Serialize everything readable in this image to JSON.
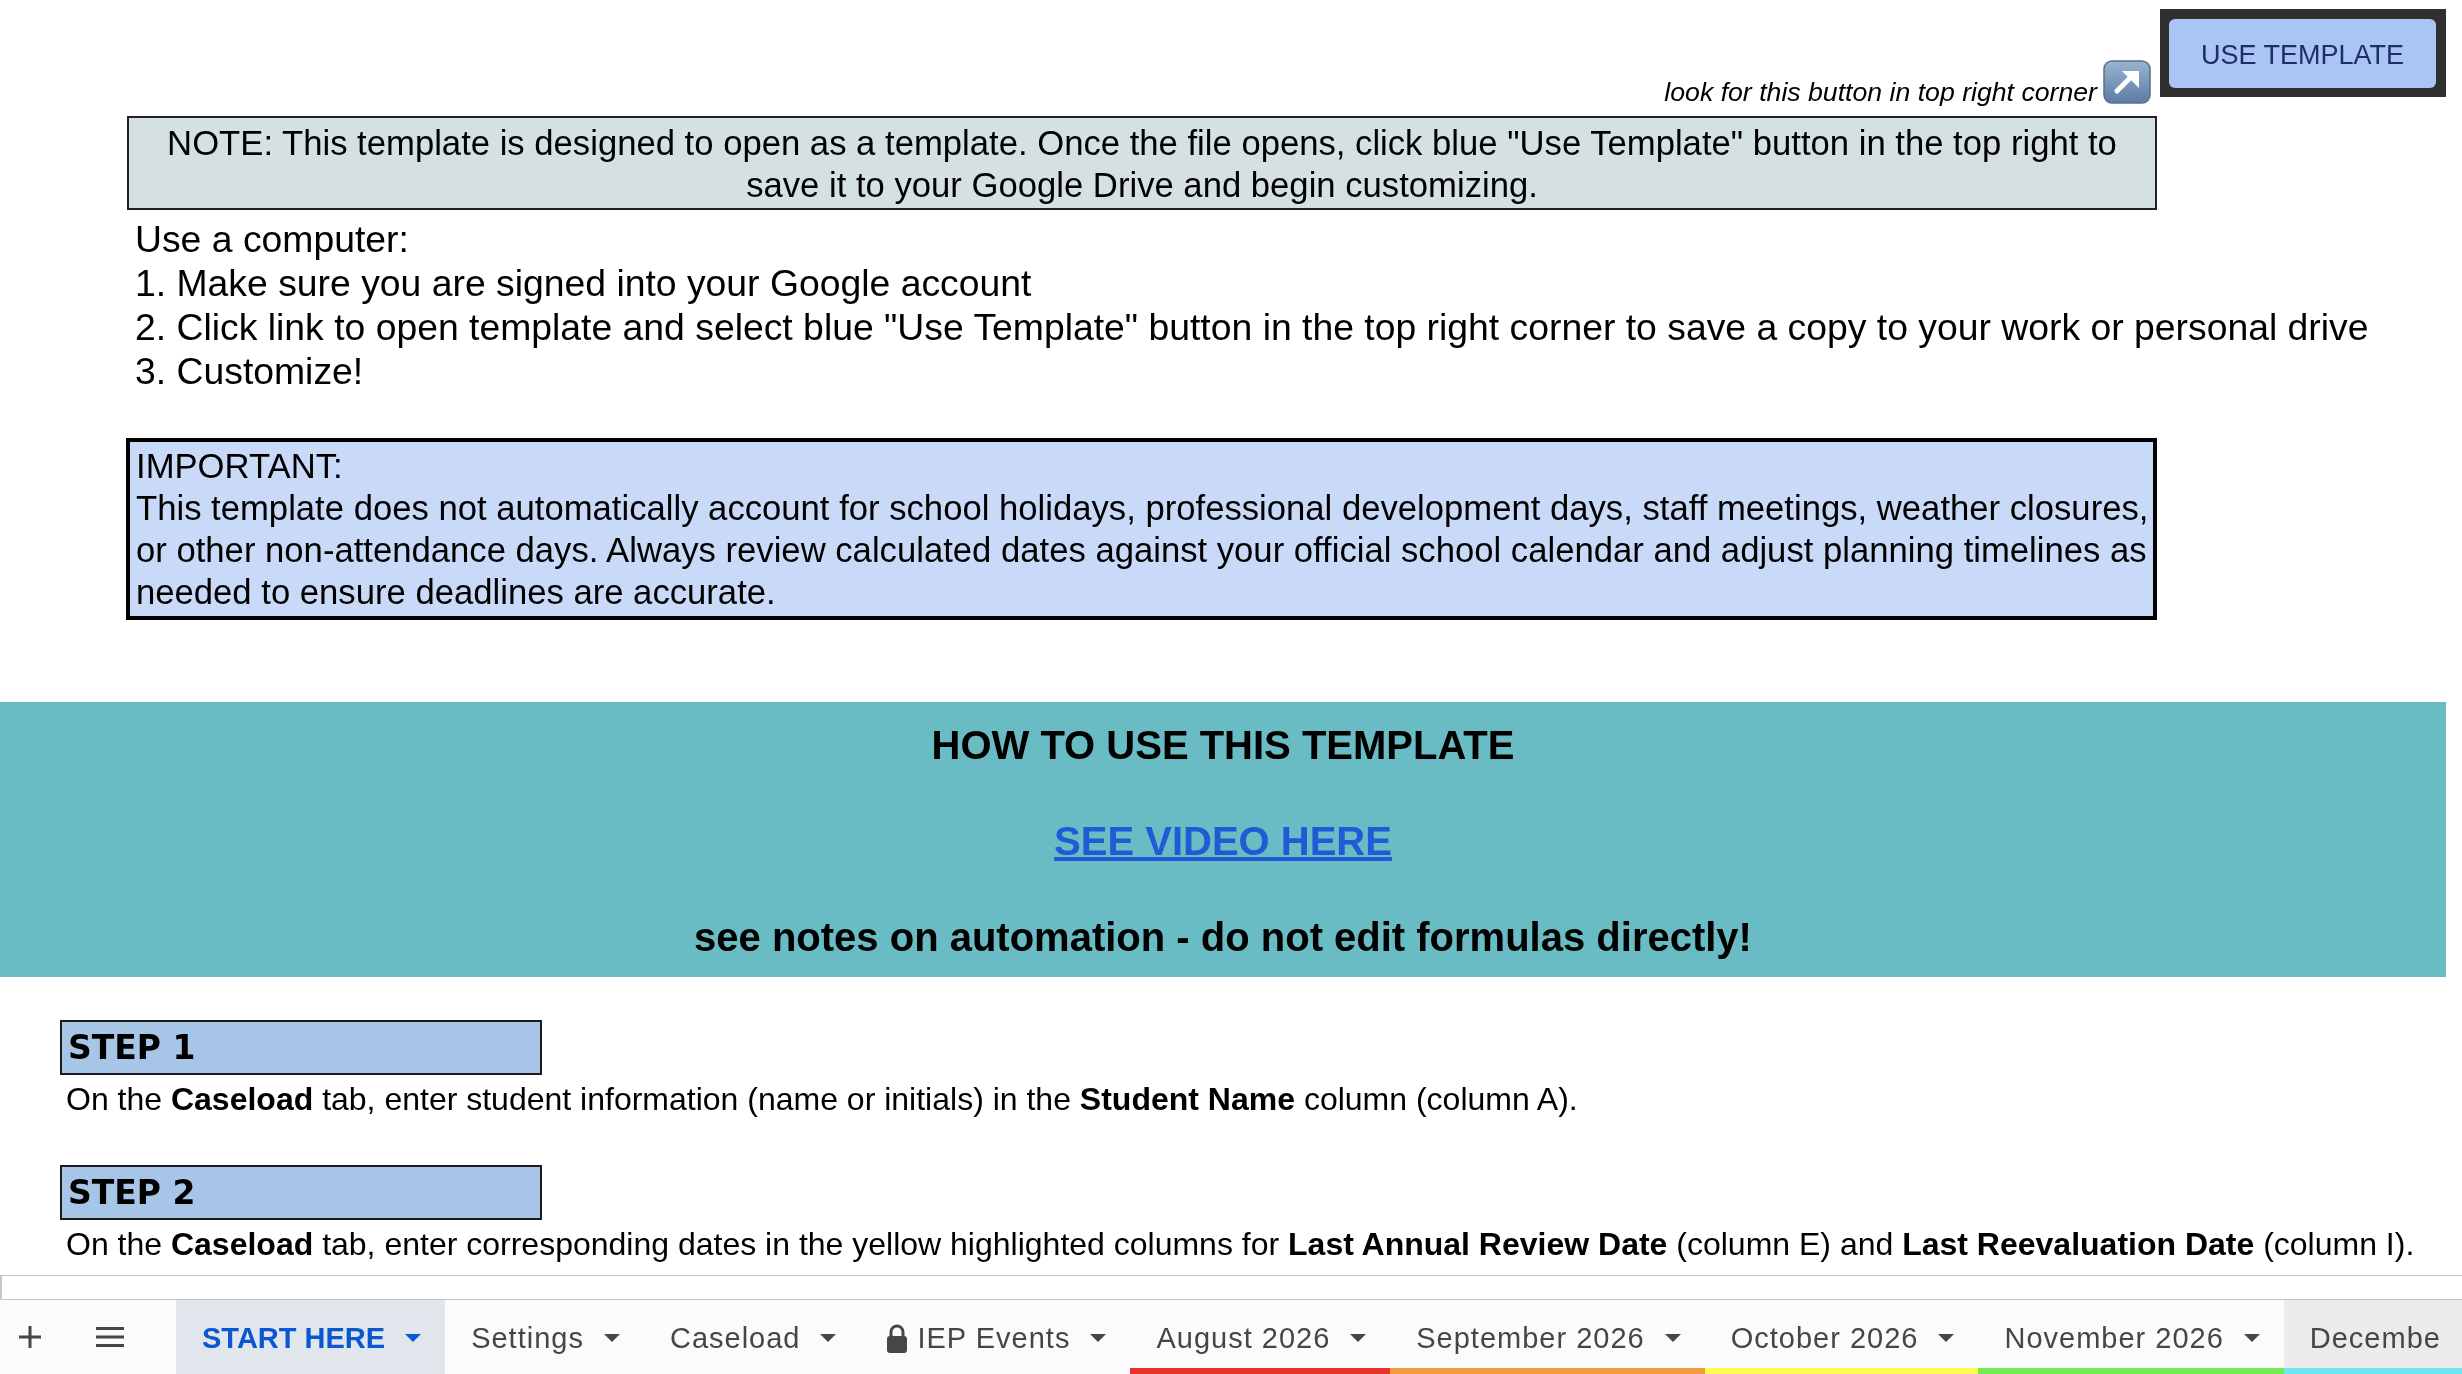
{
  "header": {
    "hint": "look for this button in top right corner",
    "button": "USE TEMPLATE"
  },
  "note": "NOTE: This template is designed to open as a template. Once the file opens, click blue \"Use Template\" button in the top right to save it to your Google Drive and begin customizing.",
  "instructions": {
    "heading": "Use a computer:",
    "steps": [
      "1. Make sure you are signed into your Google account",
      "2. Click link to open template and select blue \"Use Template\" button in the top right corner to save a copy to your work or personal drive",
      "3. Customize!"
    ]
  },
  "important": {
    "heading": "IMPORTANT:",
    "text": "This template does not automatically account for school holidays, professional development days, staff meetings, weather closures, or other non-attendance days. Always review calculated dates against your official school calendar and adjust planning timelines as needed to ensure deadlines are accurate."
  },
  "banner": {
    "title": "HOW TO USE THIS TEMPLATE",
    "link": "SEE VIDEO HERE",
    "subtitle": "see notes on automation - do not edit formulas directly!"
  },
  "steps": [
    {
      "title": "STEP 1",
      "text": "On the **Caseload** tab, enter student information (name or initials) in the **Student Name** column (column A)."
    },
    {
      "title": "STEP 2",
      "text": "On the **Caseload** tab, enter corresponding dates in the yellow highlighted columns for **Last Annual Review Date** (column E) and **Last Reevaluation Date** (column I)."
    }
  ],
  "sheet_tabs": [
    {
      "label": "START HERE",
      "selected": true,
      "hovered": false,
      "locked": false,
      "dropdown": true
    },
    {
      "label": "Settings",
      "selected": false,
      "hovered": false,
      "locked": false,
      "dropdown": true
    },
    {
      "label": "Caseload",
      "selected": false,
      "hovered": false,
      "locked": false,
      "dropdown": true
    },
    {
      "label": "IEP Events",
      "selected": false,
      "hovered": false,
      "locked": true,
      "dropdown": true
    },
    {
      "label": "August 2026",
      "selected": false,
      "hovered": false,
      "locked": false,
      "dropdown": true,
      "color": "#e8332d"
    },
    {
      "label": "September 2026",
      "selected": false,
      "hovered": false,
      "locked": false,
      "dropdown": true,
      "color": "#f19a3e"
    },
    {
      "label": "October 2026",
      "selected": false,
      "hovered": false,
      "locked": false,
      "dropdown": true,
      "color": "#fdfc53"
    },
    {
      "label": "November 2026",
      "selected": false,
      "hovered": false,
      "locked": false,
      "dropdown": true,
      "color": "#74ea55"
    },
    {
      "label": "Decembe",
      "selected": false,
      "hovered": true,
      "locked": false,
      "dropdown": false,
      "color": "#6ee6f2"
    }
  ]
}
